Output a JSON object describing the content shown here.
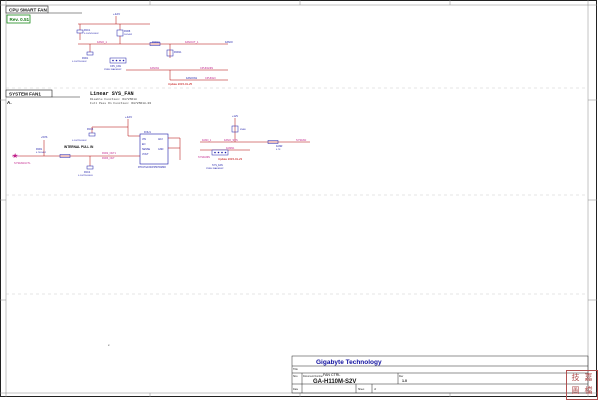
{
  "header": {
    "cpu_title": "CPU SMART FAN",
    "rev_label": "Rev. 0.51",
    "system_title": "SYSTEM FAN1",
    "section_letter": "A."
  },
  "notes": {
    "linear_title": "Linear SYS_FAN",
    "linear_line1": "Disable Function: R8725R18",
    "linear_line2": "Full Pass On Function: R8725R18-R4",
    "internal_pullin": "INTERNAL PULL IN",
    "update1": "Update 2015-01-25",
    "update2": "Update 2015-01-23"
  },
  "cpu_fan": {
    "power_top": "+12V",
    "caps": [
      "FNC1\n0.1U/50V/0402",
      "FND1\n0.1U/25V/0402"
    ],
    "resistor_top": "FNR8\n1K/0402",
    "net_fan1": "FANO_1",
    "res_a": "FNR10",
    "net_a": "FANOUT_1",
    "res_b": "FNR11",
    "net_c": "FANIO",
    "net_d": "FANIN1",
    "out_d": "CPUFANIN",
    "connector": "CPU_FAN\nPWR4 WAFER4P",
    "bottom_net": "FANOIN1",
    "bottom_out": "CPUFAN"
  },
  "system_fan": {
    "power_top": "+12V",
    "cap_top": "FNC3\n0.1U/25V/0402",
    "ic_name": "FNU1",
    "ic_part": "RT9173A/NCP4567DMR2",
    "ic_pins": [
      "VIN",
      "EN",
      "SENSE",
      "VOUT",
      "ADJ",
      "GND"
    ],
    "signal_in": "SYSFAN1CTL",
    "res_in": "FNR1\n4.7K/0402",
    "cap_bottom": "FNC4\n0.1U/25V/0603",
    "right_net": "FANO_SYS",
    "right_res": "FANR\n4.7K",
    "right_out": "SYSFAN",
    "connector": "SYS_FAN\nPWR4 WAFER4P",
    "fan_in": "SYSFANIN"
  },
  "title_block": {
    "company": "Gigabyte Technology",
    "title_label": "Title",
    "title_value": "FAN CTRL",
    "size_label": "Size",
    "doc_label": "Document Number",
    "doc_value": "GA-H110M-S2V",
    "rev_label": "Rev",
    "rev_value": "1.0",
    "date_label": "Date",
    "sheet_label": "Sheet",
    "of_label": "of"
  },
  "stamp_chars": [
    "技",
    "嘉",
    "圖",
    "檔"
  ],
  "colors": {
    "wire": "#b00000",
    "component": "#1a1aa8",
    "net_label": "#c0208a",
    "frame": "#222222",
    "company": "#1010a0"
  }
}
